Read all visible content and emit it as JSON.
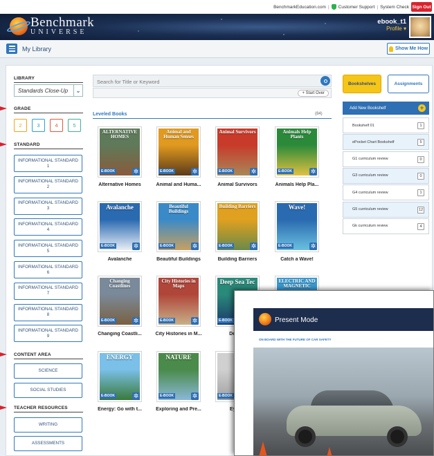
{
  "top_links": {
    "site": "BenchmarkEducation.com",
    "separator": "|",
    "support": "Customer Support",
    "system": "System Check",
    "sign_out": "Sign Out"
  },
  "brand": {
    "line1": "Benchmark",
    "line2": "UNIVERSE"
  },
  "user": {
    "name": "ebook_t1",
    "profile": "Profile ▾"
  },
  "library_bar": {
    "title": "My Library",
    "show_me": "Show Me How"
  },
  "sidebar": {
    "library_heading": "LIBRARY",
    "library_value": "Standards Close-Up",
    "grade_heading": "GRADE",
    "grades": [
      "2",
      "3",
      "4",
      "5"
    ],
    "grade_colors": [
      "#f0a21c",
      "#2a9fd6",
      "#e2553a",
      "#3fae9e"
    ],
    "standard_heading": "STANDARD",
    "standards": [
      "INFORMATIONAL STANDARD 1",
      "INFORMATIONAL STANDARD 2",
      "INFORMATIONAL STANDARD 3",
      "INFORMATIONAL STANDARD 4",
      "INFORMATIONAL STANDARD 5",
      "INFORMATIONAL STANDARD 6",
      "INFORMATIONAL STANDARD 7",
      "INFORMATIONAL STANDARD 8",
      "INFORMATIONAL STANDARD 9"
    ],
    "content_heading": "CONTENT AREA",
    "content_areas": [
      "SCIENCE",
      "SOCIAL STUDIES"
    ],
    "teacher_heading": "TEACHER RESOURCES",
    "teacher_resources": [
      "WRITING",
      "ASSESSMENTS"
    ]
  },
  "search": {
    "placeholder": "Search for Title or Keyword",
    "start_over": "+ Start Over"
  },
  "leveled": {
    "title": "Leveled Books",
    "count": "(84)"
  },
  "book_tag": "E-BOOK",
  "books": [
    {
      "label": "Alternative Homes",
      "cover": "ALTERNATIVE HOMES",
      "c1": "#5e7a5a",
      "c2": "#8a5a3a"
    },
    {
      "label": "Animal and Huma...",
      "cover": "Animal and Human Senses",
      "c1": "#e09a20",
      "c2": "#5a3a1a"
    },
    {
      "label": "Animal Survivors",
      "cover": "Animal Survivors",
      "c1": "#c83a2a",
      "c2": "#a88858"
    },
    {
      "label": "Animals Help Pla...",
      "cover": "Animals Help Plants",
      "c1": "#2a8a3a",
      "c2": "#e0c040"
    },
    {
      "label": "Avalanche",
      "cover": "Avalanche",
      "c1": "#2a6ab0",
      "c2": "#e8eef6"
    },
    {
      "label": "Beautiful Buildings",
      "cover": "Beautiful Buildings",
      "c1": "#3a8ac8",
      "c2": "#c8a060"
    },
    {
      "label": "Building Barriers",
      "cover": "Building Barriers",
      "c1": "#e0a020",
      "c2": "#6a8a4a"
    },
    {
      "label": "Catch a Wave!",
      "cover": "Wave!",
      "c1": "#2a6ab0",
      "c2": "#6ac0e0"
    },
    {
      "label": "Changing Coastli...",
      "cover": "Changing Coastlines",
      "c1": "#7a8a9a",
      "c2": "#7a6040"
    },
    {
      "label": "City Histories in M...",
      "cover": "City Histories in Maps",
      "c1": "#b0453a",
      "c2": "#c8b088"
    },
    {
      "label": "Deep S",
      "cover": "Deep Sea Tec",
      "c1": "#2a8a7a",
      "c2": "#1a3a6a"
    },
    {
      "label": "",
      "cover": "ELECTRIC AND MAGNETIC",
      "c1": "#3a9ad0",
      "c2": "#e0c040"
    },
    {
      "label": "Energy: Go with t...",
      "cover": "ENERGY",
      "c1": "#7ac0e8",
      "c2": "#3a7a3a"
    },
    {
      "label": "Exploring and Pre...",
      "cover": "NATURE",
      "c1": "#4a8a4a",
      "c2": "#8ab8d8"
    },
    {
      "label": "Eyewit",
      "cover": "",
      "c1": "#d0d0d0",
      "c2": "#a0a0a0"
    }
  ],
  "shelves": {
    "tab_shelves": "Bookshelves",
    "tab_assignments": "Assignments",
    "add": "Add New Bookshelf",
    "items": [
      {
        "name": "Bookshelf 01",
        "count": "1"
      },
      {
        "name": "ePocket Chart Bookshelf",
        "count": "5"
      },
      {
        "name": "G1 curriculum review",
        "count": "0"
      },
      {
        "name": "G3 curriculum review",
        "count": "0"
      },
      {
        "name": "G4 curriculum review",
        "count": "1"
      },
      {
        "name": "G5 curriculum review",
        "count": "12"
      },
      {
        "name": "Gk curriculum review",
        "count": "4"
      }
    ]
  },
  "present": {
    "title": "Present Mode",
    "subtitle": "ON BOARD WITH THE FUTURE OF CAR SAFETY"
  }
}
